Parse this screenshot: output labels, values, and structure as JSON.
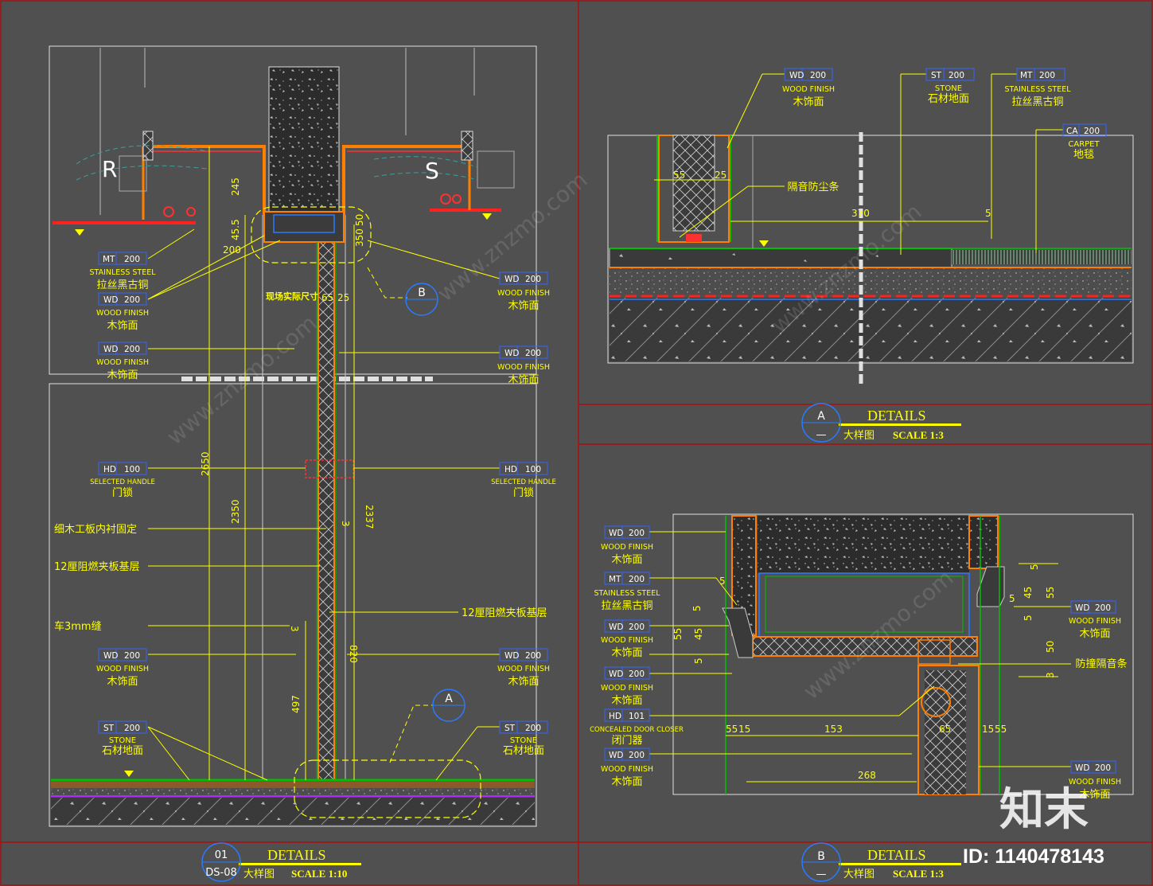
{
  "tags": {
    "wd": "WD",
    "mt": "MT",
    "st": "ST",
    "hd": "HD",
    "ca": "CA",
    "n200": "200",
    "n100": "100",
    "n101": "101"
  },
  "labels": {
    "stainless_en": "STAINLESS STEEL",
    "stainless_cn": "拉丝黑古铜",
    "wood_en": "WOOD FINISH",
    "wood_cn": "木饰面",
    "stone_en": "STONE",
    "stone_cn": "石材地面",
    "handle_en": "SELECTED HANDLE",
    "handle_cn": "门锁",
    "carpet_en": "CARPET",
    "carpet_cn": "地毯",
    "closer_en": "CONCEALED DOOR CLOSER",
    "closer_cn": "闭门器",
    "seal_dust": "隔音防尘条",
    "seal_anti": "防撞隔音条",
    "note_site": "现场实际尺寸",
    "note_plank": "细木工板内衬固定",
    "note_fire1": "12厘阻燃夹板基层",
    "note_fire2": "12厘阻燃夹板基层",
    "note_gap": "车3mm缝"
  },
  "room_marks": {
    "r": "R",
    "s": "S"
  },
  "dims": {
    "d245": "245",
    "d45_5": "45.5",
    "d200": "200",
    "d350": "350",
    "d50": "50",
    "d65": "65",
    "d25": "25",
    "d2650": "2650",
    "d2350": "2350",
    "d2337": "2337",
    "d3": "3",
    "d820": "820",
    "d497": "497",
    "a55": "55",
    "a25": "25",
    "a370": "370",
    "a5": "5",
    "b5": "5",
    "b55": "55",
    "b45": "45",
    "b50": "50",
    "b3": "3",
    "b15": "15",
    "b153": "153",
    "b65": "65",
    "b268": "268"
  },
  "callouts": {
    "a_letter": "A",
    "b_letter": "B"
  },
  "titles": {
    "main": {
      "num": "01",
      "sheet": "DS-08",
      "title": "DETAILS",
      "sub": "大样图",
      "scale": "SCALE 1:10"
    },
    "a": {
      "letter": "A",
      "dash": "—",
      "title": "DETAILS",
      "sub": "大样图",
      "scale": "SCALE 1:3"
    },
    "b": {
      "letter": "B",
      "dash": "—",
      "title": "DETAILS",
      "sub": "大样图",
      "scale": "SCALE 1:3"
    }
  },
  "watermark": {
    "logo": "知末",
    "id": "ID: 1140478143",
    "site": "www.znzmo.com"
  },
  "colors": {
    "bg": "#505050",
    "frame": "#c00000",
    "leader": "#ffff00",
    "tag_box": "#3366ff",
    "finish": "#ff8000",
    "concrete": "#2e2e2e",
    "green": "#00c000",
    "red": "#ff0000"
  }
}
